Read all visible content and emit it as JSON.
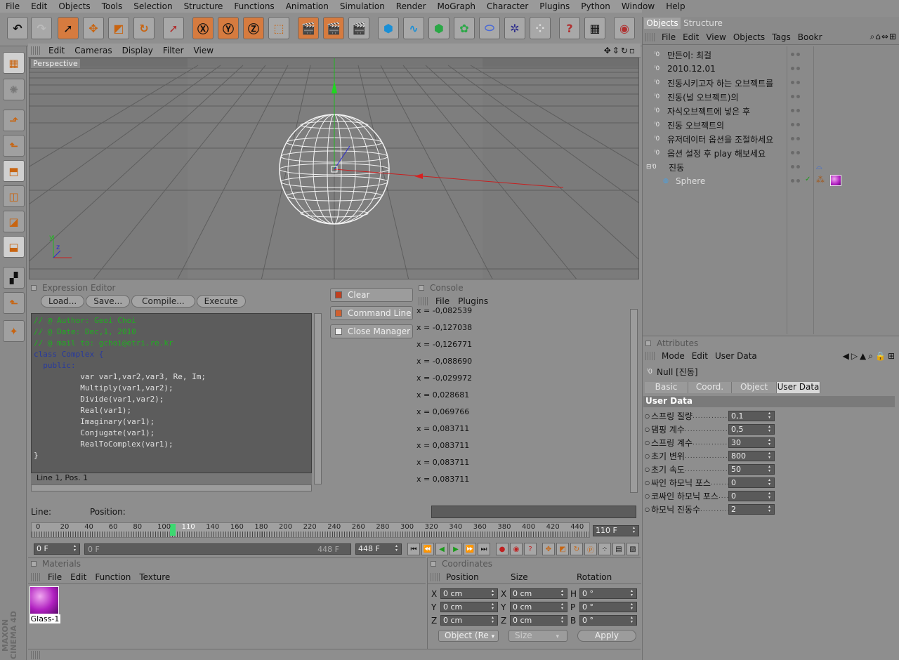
{
  "menu": [
    "File",
    "Edit",
    "Objects",
    "Tools",
    "Selection",
    "Structure",
    "Functions",
    "Animation",
    "Simulation",
    "Render",
    "MoGraph",
    "Character",
    "Plugins",
    "Python",
    "Window",
    "Help"
  ],
  "viewport": {
    "menu": [
      "Edit",
      "Cameras",
      "Display",
      "Filter",
      "View"
    ],
    "label": "Perspective"
  },
  "expression_editor": {
    "title": "Expression Editor",
    "buttons": [
      "Load...",
      "Save...",
      "Compile...",
      "Execute"
    ],
    "code_lines": [
      {
        "cls": "cmt",
        "text": "// @ Author: Geoi Choi"
      },
      {
        "cls": "cmt",
        "text": "// @ Date: Dec,1, 2010"
      },
      {
        "cls": "cmt",
        "text": "// @ mail to: gchoi@etri.re.kr"
      },
      {
        "cls": "kw",
        "text": "class Complex {"
      },
      {
        "cls": "kw",
        "text": "  public:"
      },
      {
        "cls": "code",
        "text": "          var var1,var2,var3, Re, Im;"
      },
      {
        "cls": "code",
        "text": "          Multiply(var1,var2);"
      },
      {
        "cls": "code",
        "text": "          Divide(var1,var2);"
      },
      {
        "cls": "code",
        "text": "          Real(var1);"
      },
      {
        "cls": "code",
        "text": "          Imaginary(var1);"
      },
      {
        "cls": "code",
        "text": "          Conjugate(var1);"
      },
      {
        "cls": "code",
        "text": "          RealToComplex(var1);"
      },
      {
        "cls": "code",
        "text": "}"
      }
    ],
    "status": "Line 1, Pos. 1",
    "line_label": "Line:",
    "position_label": "Position:",
    "side_buttons": [
      "Clear",
      "Command Line",
      "Close Manager"
    ]
  },
  "console": {
    "title": "Console",
    "menu": [
      "File",
      "Plugins"
    ],
    "lines": [
      "x = -0,082539",
      "x = -0,127038",
      "x = -0,126771",
      "x = -0,088690",
      "x = -0,029972",
      "x = 0,028681",
      "x = 0,069766",
      "x = 0,083711",
      "x = 0,083711",
      "x = 0,083711",
      "x = 0,083711"
    ]
  },
  "objects": {
    "tabs": [
      "Objects",
      "Structure"
    ],
    "menu": [
      "File",
      "Edit",
      "View",
      "Objects",
      "Tags",
      "Bookr"
    ],
    "items": [
      "만든이: 최걸",
      "2010.12.01",
      "진동시키고자 하는 오브젝트를",
      "진동(널 오브젝트)의",
      "자식오브젝트에 넣은 후",
      "진동 오브젝트의",
      "유저데이터 옵션을 조절하세요",
      "옵션 설정 후 play 해보세요",
      "진동",
      "Sphere"
    ]
  },
  "attributes": {
    "title": "Attributes",
    "menu": [
      "Mode",
      "Edit",
      "User Data"
    ],
    "object_name": "Null [진동]",
    "tabs": [
      "Basic",
      "Coord.",
      "Object",
      "User Data"
    ],
    "section": "User Data",
    "params": [
      {
        "label": "스프링 질량",
        "value": "0,1"
      },
      {
        "label": "댐핑 계수",
        "value": "0,5"
      },
      {
        "label": "스프링 계수",
        "value": "30"
      },
      {
        "label": "초기 변위",
        "value": "800"
      },
      {
        "label": "초기 속도",
        "value": "50"
      },
      {
        "label": "싸인 하모닉 포스",
        "value": "0"
      },
      {
        "label": "코싸인 하모닉 포스",
        "value": "0"
      },
      {
        "label": "하모닉 진동수",
        "value": "2"
      }
    ]
  },
  "timeline": {
    "ticks": [
      "0",
      "20",
      "40",
      "60",
      "80",
      "100",
      "110",
      "140",
      "160",
      "180",
      "200",
      "220",
      "240",
      "260",
      "280",
      "300",
      "320",
      "340",
      "360",
      "380",
      "400",
      "420",
      "440"
    ],
    "current_frame": "110 F",
    "start": "0 F",
    "range_start": "0 F",
    "range_end": "448 F",
    "end": "448 F"
  },
  "materials": {
    "title": "Materials",
    "menu": [
      "File",
      "Edit",
      "Function",
      "Texture"
    ],
    "item": "Glass-1"
  },
  "coordinates": {
    "title": "Coordinates",
    "headers": [
      "Position",
      "Size",
      "Rotation"
    ],
    "rows": [
      {
        "axis": "X",
        "pos": "0 cm",
        "saxis": "X",
        "size": "0 cm",
        "raxis": "H",
        "rot": "0 °"
      },
      {
        "axis": "Y",
        "pos": "0 cm",
        "saxis": "Y",
        "size": "0 cm",
        "raxis": "P",
        "rot": "0 °"
      },
      {
        "axis": "Z",
        "pos": "0 cm",
        "saxis": "Z",
        "size": "0 cm",
        "raxis": "B",
        "rot": "0 °"
      }
    ],
    "mode": "Object (Re",
    "size_mode": "Size",
    "apply": "Apply"
  },
  "brand": "MAXON CINEMA 4D"
}
